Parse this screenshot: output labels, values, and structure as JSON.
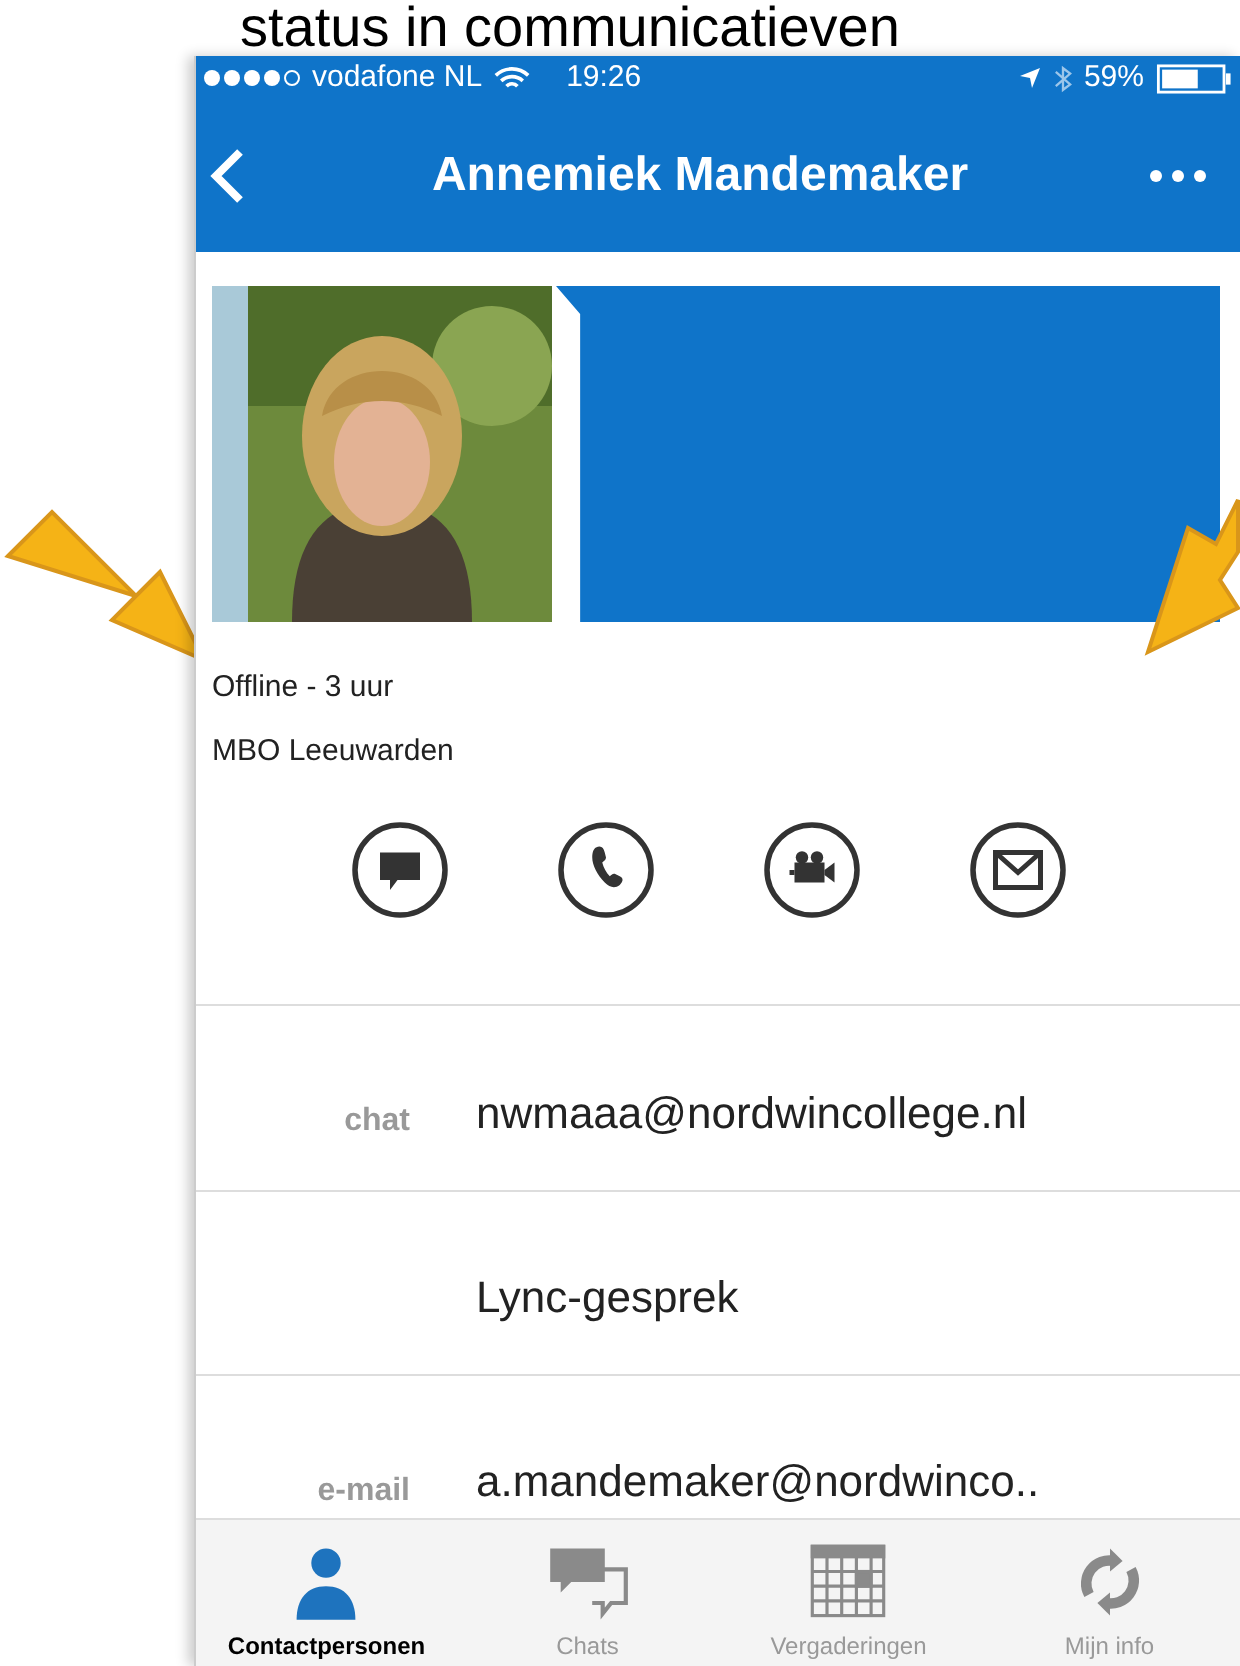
{
  "heading": "status in communicatieven",
  "status_bar": {
    "carrier": "vodafone NL",
    "time": "19:26",
    "battery": "59%"
  },
  "nav": {
    "title": "Annemiek Mandemaker"
  },
  "profile": {
    "status": "Offline - 3 uur",
    "organisation": "MBO Leeuwarden"
  },
  "actions": [
    {
      "kind": "chat"
    },
    {
      "kind": "phone"
    },
    {
      "kind": "video"
    },
    {
      "kind": "mail"
    }
  ],
  "details": [
    {
      "label": "chat",
      "value": "nwmaaa@nordwincollege.nl"
    },
    {
      "value": "Lync-gesprek"
    },
    {
      "label": "e-mail",
      "value": "a.mandemaker@nordwinco.."
    }
  ],
  "tabs": [
    {
      "label": "Contactpersonen",
      "kind": "person",
      "selected": true
    },
    {
      "label": "Chats",
      "kind": "chats",
      "selected": false
    },
    {
      "label": "Vergaderingen",
      "kind": "calendar",
      "selected": false
    },
    {
      "label": "Mijn info",
      "kind": "sync",
      "selected": false
    }
  ]
}
